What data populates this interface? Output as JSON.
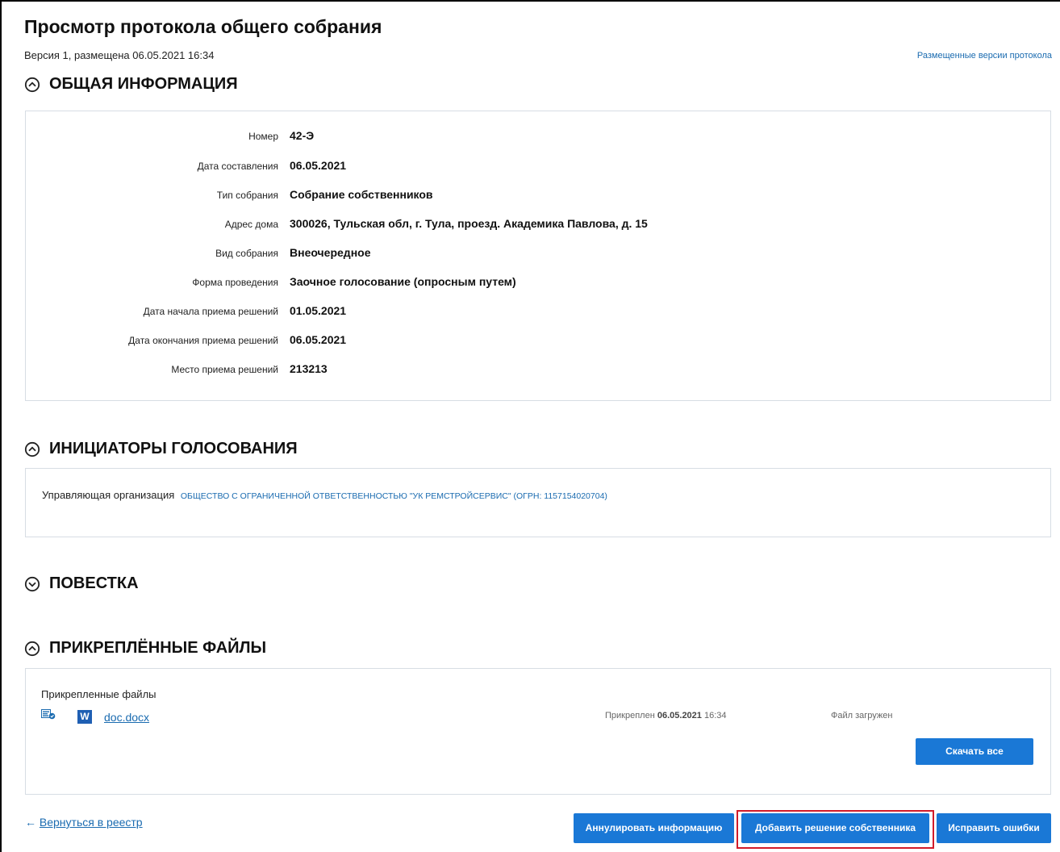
{
  "header": {
    "title": "Просмотр протокола общего собрания",
    "version": "Версия 1, размещена 06.05.2021 16:34",
    "versions_link": "Размещенные версии протокола"
  },
  "general": {
    "heading": "ОБЩАЯ ИНФОРМАЦИЯ",
    "expanded": true,
    "fields": [
      {
        "label": "Номер",
        "value": "42-Э"
      },
      {
        "label": "Дата составления",
        "value": "06.05.2021"
      },
      {
        "label": "Тип собрания",
        "value": "Собрание собственников"
      },
      {
        "label": "Адрес дома",
        "value": "300026, Тульская обл, г. Тула, проезд. Академика Павлова, д. 15"
      },
      {
        "label": "Вид собрания",
        "value": "Внеочередное"
      },
      {
        "label": "Форма проведения",
        "value": "Заочное голосование (опросным путем)"
      },
      {
        "label": "Дата начала приема решений",
        "value": "01.05.2021"
      },
      {
        "label": "Дата окончания приема решений",
        "value": "06.05.2021"
      },
      {
        "label": "Место приема решений",
        "value": "213213"
      }
    ]
  },
  "initiators": {
    "heading": "ИНИЦИАТОРЫ ГОЛОСОВАНИЯ",
    "expanded": true,
    "label": "Управляющая организация",
    "org": "ОБЩЕСТВО С ОГРАНИЧЕННОЙ ОТВЕТСТВЕННОСТЬЮ \"УК РЕМСТРОЙСЕРВИС\" (ОГРН: 1157154020704)"
  },
  "agenda": {
    "heading": "ПОВЕСТКА",
    "expanded": false
  },
  "files": {
    "heading": "ПРИКРЕПЛЁННЫЕ ФАЙЛЫ",
    "expanded": true,
    "title": "Прикрепленные файлы",
    "word_icon_letter": "W",
    "items": [
      {
        "name": "doc.docx",
        "attached_prefix": "Прикреплен",
        "attached_date": "06.05.2021",
        "attached_time": "16:34",
        "status": "Файл загружен"
      }
    ],
    "download_all": "Скачать все"
  },
  "footer": {
    "back_arrow": "←",
    "back_label": "Вернуться в реестр",
    "annul": "Аннулировать информацию",
    "add_decision": "Добавить решение собственника",
    "fix_errors": "Исправить ошибки"
  },
  "colors": {
    "accent": "#1a78d6",
    "link": "#1a6bb0",
    "highlight": "#d11b2a"
  }
}
